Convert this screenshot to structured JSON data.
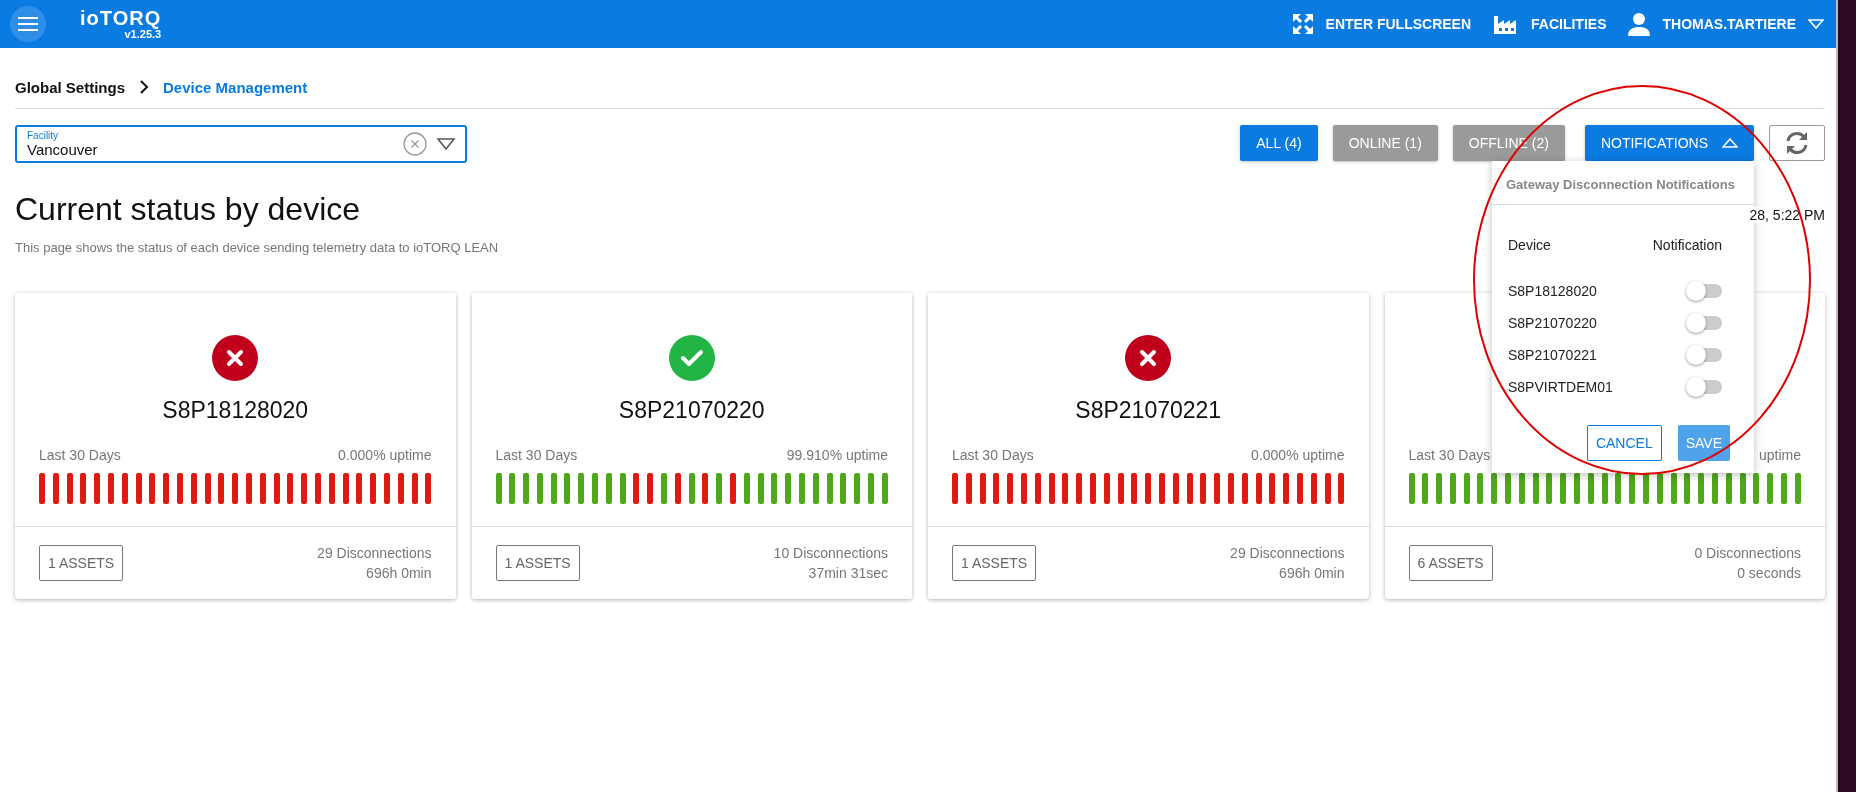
{
  "app_bar": {
    "logo": "ioTORQ",
    "version": "v1.25.3",
    "actions": [
      {
        "kind": "fullscreen",
        "label": "ENTER FULLSCREEN"
      },
      {
        "kind": "facilities",
        "label": "FACILITIES"
      },
      {
        "kind": "user",
        "label": "THOMAS.TARTIERE"
      }
    ]
  },
  "breadcrumb": [
    {
      "label": "Global Settings",
      "selected": false
    },
    {
      "label": "Device Management",
      "selected": true
    }
  ],
  "facility_field": {
    "label": "Facility",
    "value": "Vancouver"
  },
  "filters": [
    {
      "label": "ALL (4)",
      "selected": true
    },
    {
      "label": "ONLINE (1)",
      "selected": false
    },
    {
      "label": "OFFLINE (2)",
      "selected": false
    }
  ],
  "notifications_button": {
    "label": "NOTIFICATIONS",
    "expanded": true
  },
  "title": "Current status by device",
  "subtitle": "This page shows the status of each device sending telemetry data to ioTORQ LEAN",
  "timestamp": "28, 5:22 PM",
  "cards": [
    {
      "online": false,
      "name": "S8P18128020",
      "period": "Last 30 Days",
      "uptime": "0.000% uptime",
      "days": [
        false,
        false,
        false,
        false,
        false,
        false,
        false,
        false,
        false,
        false,
        false,
        false,
        false,
        false,
        false,
        false,
        false,
        false,
        false,
        false,
        false,
        false,
        false,
        false,
        false,
        false,
        false,
        false,
        false
      ],
      "assets": "1 ASSETS",
      "disconnections": "29 Disconnections",
      "downtime": "696h 0min"
    },
    {
      "online": true,
      "name": "S8P21070220",
      "period": "Last 30 Days",
      "uptime": "99.910% uptime",
      "days": [
        true,
        true,
        true,
        true,
        true,
        true,
        true,
        true,
        true,
        true,
        false,
        false,
        true,
        false,
        true,
        false,
        true,
        false,
        true,
        true,
        true,
        true,
        true,
        true,
        true,
        true,
        true,
        true,
        true
      ],
      "assets": "1 ASSETS",
      "disconnections": "10 Disconnections",
      "downtime": "37min 31sec"
    },
    {
      "online": false,
      "name": "S8P21070221",
      "period": "Last 30 Days",
      "uptime": "0.000% uptime",
      "days": [
        false,
        false,
        false,
        false,
        false,
        false,
        false,
        false,
        false,
        false,
        false,
        false,
        false,
        false,
        false,
        false,
        false,
        false,
        false,
        false,
        false,
        false,
        false,
        false,
        false,
        false,
        false,
        false,
        false
      ],
      "assets": "1 ASSETS",
      "disconnections": "29 Disconnections",
      "downtime": "696h 0min"
    },
    {
      "period": "Last 30 Days",
      "uptime": "uptime",
      "days": [
        true,
        true,
        true,
        true,
        true,
        true,
        true,
        true,
        true,
        true,
        true,
        true,
        true,
        true,
        true,
        true,
        true,
        true,
        true,
        true,
        true,
        true,
        true,
        true,
        true,
        true,
        true,
        true,
        true
      ],
      "assets": "6 ASSETS",
      "disconnections": "0 Disconnections",
      "downtime": "0 seconds"
    }
  ],
  "notifications_menu": {
    "title": "Gateway Disconnection Notifications",
    "columns": [
      "Device",
      "Notification"
    ],
    "rows": [
      {
        "device": "S8P18128020",
        "on": false
      },
      {
        "device": "S8P21070220",
        "on": false
      },
      {
        "device": "S8P21070221",
        "on": false
      },
      {
        "device": "S8PVIRTDEM01",
        "on": false
      }
    ],
    "cancel": "CANCEL",
    "save": "SAVE"
  },
  "annotation_ellipse": true
}
